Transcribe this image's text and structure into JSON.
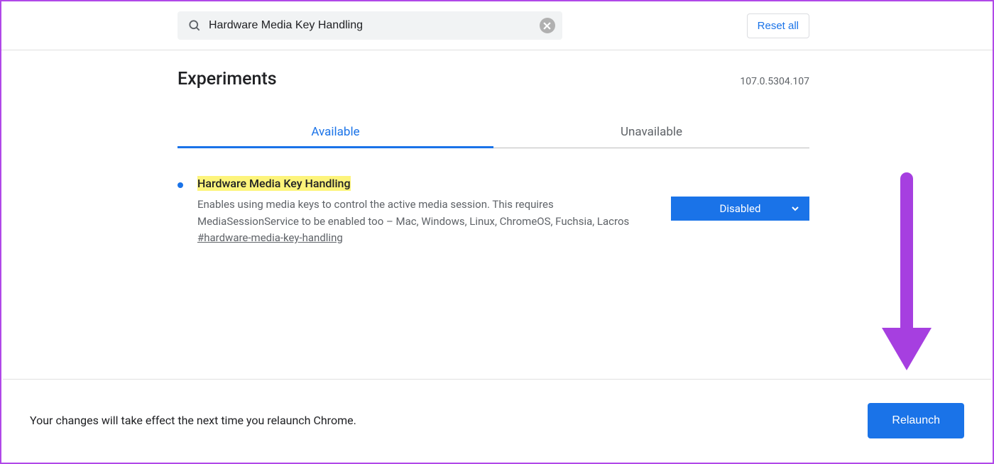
{
  "search": {
    "value": "Hardware Media Key Handling"
  },
  "reset_label": "Reset all",
  "page_title": "Experiments",
  "version": "107.0.5304.107",
  "tabs": {
    "available": "Available",
    "unavailable": "Unavailable"
  },
  "flag": {
    "title": "Hardware Media Key Handling",
    "description": "Enables using media keys to control the active media session. This requires MediaSessionService to be enabled too – Mac, Windows, Linux, ChromeOS, Fuchsia, Lacros",
    "anchor": "#hardware-media-key-handling",
    "selected": "Disabled"
  },
  "bottom": {
    "message": "Your changes will take effect the next time you relaunch Chrome.",
    "button": "Relaunch"
  }
}
